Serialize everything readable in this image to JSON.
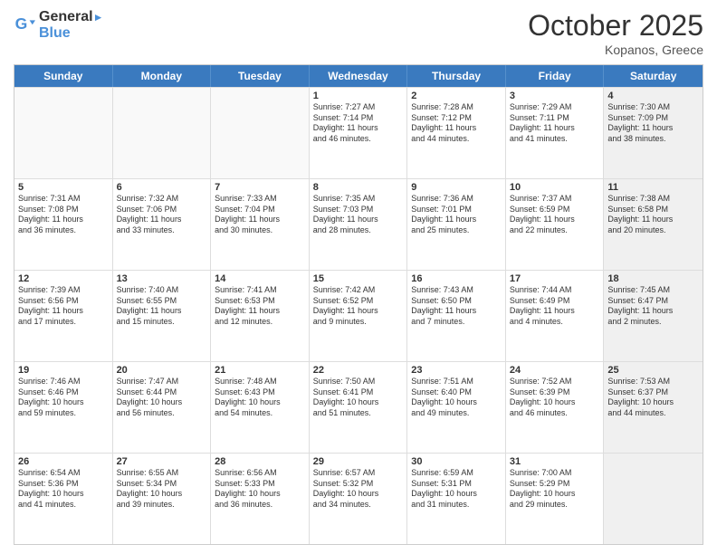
{
  "header": {
    "logo_line1": "General",
    "logo_line2": "Blue",
    "month": "October 2025",
    "location": "Kopanos, Greece"
  },
  "weekdays": [
    "Sunday",
    "Monday",
    "Tuesday",
    "Wednesday",
    "Thursday",
    "Friday",
    "Saturday"
  ],
  "rows": [
    [
      {
        "day": "",
        "info": "",
        "empty": true
      },
      {
        "day": "",
        "info": "",
        "empty": true
      },
      {
        "day": "",
        "info": "",
        "empty": true
      },
      {
        "day": "1",
        "info": "Sunrise: 7:27 AM\nSunset: 7:14 PM\nDaylight: 11 hours\nand 46 minutes."
      },
      {
        "day": "2",
        "info": "Sunrise: 7:28 AM\nSunset: 7:12 PM\nDaylight: 11 hours\nand 44 minutes."
      },
      {
        "day": "3",
        "info": "Sunrise: 7:29 AM\nSunset: 7:11 PM\nDaylight: 11 hours\nand 41 minutes."
      },
      {
        "day": "4",
        "info": "Sunrise: 7:30 AM\nSunset: 7:09 PM\nDaylight: 11 hours\nand 38 minutes.",
        "shaded": true
      }
    ],
    [
      {
        "day": "5",
        "info": "Sunrise: 7:31 AM\nSunset: 7:08 PM\nDaylight: 11 hours\nand 36 minutes."
      },
      {
        "day": "6",
        "info": "Sunrise: 7:32 AM\nSunset: 7:06 PM\nDaylight: 11 hours\nand 33 minutes."
      },
      {
        "day": "7",
        "info": "Sunrise: 7:33 AM\nSunset: 7:04 PM\nDaylight: 11 hours\nand 30 minutes."
      },
      {
        "day": "8",
        "info": "Sunrise: 7:35 AM\nSunset: 7:03 PM\nDaylight: 11 hours\nand 28 minutes."
      },
      {
        "day": "9",
        "info": "Sunrise: 7:36 AM\nSunset: 7:01 PM\nDaylight: 11 hours\nand 25 minutes."
      },
      {
        "day": "10",
        "info": "Sunrise: 7:37 AM\nSunset: 6:59 PM\nDaylight: 11 hours\nand 22 minutes."
      },
      {
        "day": "11",
        "info": "Sunrise: 7:38 AM\nSunset: 6:58 PM\nDaylight: 11 hours\nand 20 minutes.",
        "shaded": true
      }
    ],
    [
      {
        "day": "12",
        "info": "Sunrise: 7:39 AM\nSunset: 6:56 PM\nDaylight: 11 hours\nand 17 minutes."
      },
      {
        "day": "13",
        "info": "Sunrise: 7:40 AM\nSunset: 6:55 PM\nDaylight: 11 hours\nand 15 minutes."
      },
      {
        "day": "14",
        "info": "Sunrise: 7:41 AM\nSunset: 6:53 PM\nDaylight: 11 hours\nand 12 minutes."
      },
      {
        "day": "15",
        "info": "Sunrise: 7:42 AM\nSunset: 6:52 PM\nDaylight: 11 hours\nand 9 minutes."
      },
      {
        "day": "16",
        "info": "Sunrise: 7:43 AM\nSunset: 6:50 PM\nDaylight: 11 hours\nand 7 minutes."
      },
      {
        "day": "17",
        "info": "Sunrise: 7:44 AM\nSunset: 6:49 PM\nDaylight: 11 hours\nand 4 minutes."
      },
      {
        "day": "18",
        "info": "Sunrise: 7:45 AM\nSunset: 6:47 PM\nDaylight: 11 hours\nand 2 minutes.",
        "shaded": true
      }
    ],
    [
      {
        "day": "19",
        "info": "Sunrise: 7:46 AM\nSunset: 6:46 PM\nDaylight: 10 hours\nand 59 minutes."
      },
      {
        "day": "20",
        "info": "Sunrise: 7:47 AM\nSunset: 6:44 PM\nDaylight: 10 hours\nand 56 minutes."
      },
      {
        "day": "21",
        "info": "Sunrise: 7:48 AM\nSunset: 6:43 PM\nDaylight: 10 hours\nand 54 minutes."
      },
      {
        "day": "22",
        "info": "Sunrise: 7:50 AM\nSunset: 6:41 PM\nDaylight: 10 hours\nand 51 minutes."
      },
      {
        "day": "23",
        "info": "Sunrise: 7:51 AM\nSunset: 6:40 PM\nDaylight: 10 hours\nand 49 minutes."
      },
      {
        "day": "24",
        "info": "Sunrise: 7:52 AM\nSunset: 6:39 PM\nDaylight: 10 hours\nand 46 minutes."
      },
      {
        "day": "25",
        "info": "Sunrise: 7:53 AM\nSunset: 6:37 PM\nDaylight: 10 hours\nand 44 minutes.",
        "shaded": true
      }
    ],
    [
      {
        "day": "26",
        "info": "Sunrise: 6:54 AM\nSunset: 5:36 PM\nDaylight: 10 hours\nand 41 minutes."
      },
      {
        "day": "27",
        "info": "Sunrise: 6:55 AM\nSunset: 5:34 PM\nDaylight: 10 hours\nand 39 minutes."
      },
      {
        "day": "28",
        "info": "Sunrise: 6:56 AM\nSunset: 5:33 PM\nDaylight: 10 hours\nand 36 minutes."
      },
      {
        "day": "29",
        "info": "Sunrise: 6:57 AM\nSunset: 5:32 PM\nDaylight: 10 hours\nand 34 minutes."
      },
      {
        "day": "30",
        "info": "Sunrise: 6:59 AM\nSunset: 5:31 PM\nDaylight: 10 hours\nand 31 minutes."
      },
      {
        "day": "31",
        "info": "Sunrise: 7:00 AM\nSunset: 5:29 PM\nDaylight: 10 hours\nand 29 minutes."
      },
      {
        "day": "",
        "info": "",
        "empty": true,
        "shaded": true
      }
    ]
  ]
}
